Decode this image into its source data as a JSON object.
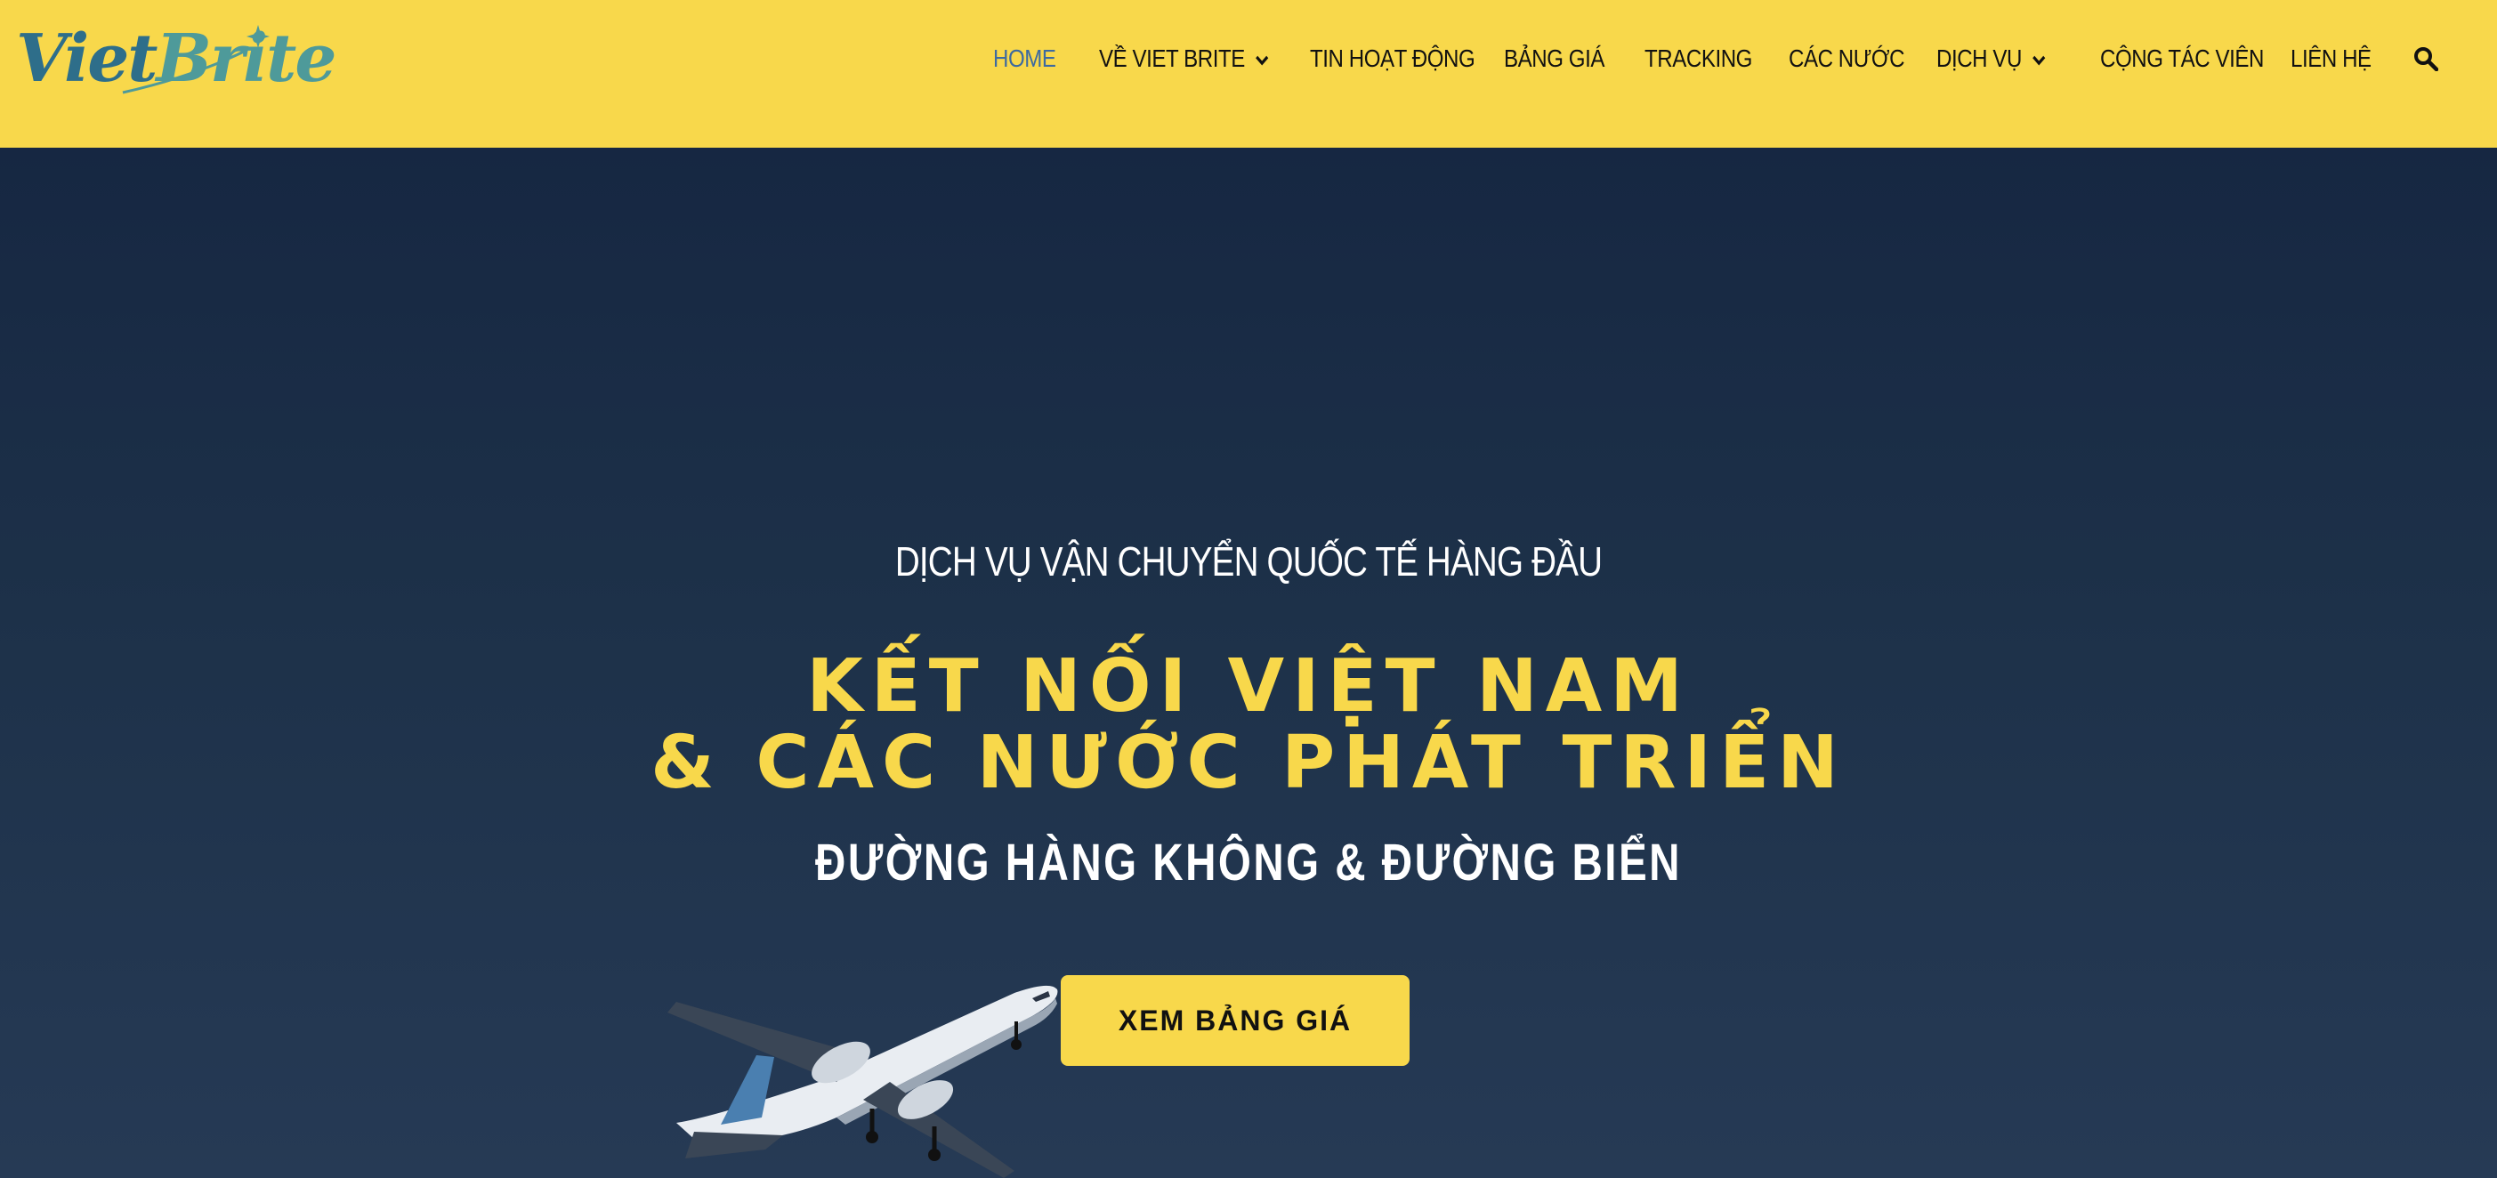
{
  "brand": {
    "logo_text_1": "Viet",
    "logo_text_2": "Brite"
  },
  "nav": {
    "items": [
      {
        "label": "HOME",
        "active": true
      },
      {
        "label": "VỀ VIET BRITE",
        "dropdown": true
      },
      {
        "label": "TIN HOẠT ĐỘNG"
      },
      {
        "label": "BẢNG GIÁ"
      },
      {
        "label": "TRACKING"
      },
      {
        "label": "CÁC NƯỚC"
      },
      {
        "label": "DỊCH VỤ",
        "dropdown": true
      },
      {
        "label": "CỘNG TÁC VIÊN"
      },
      {
        "label": "LIÊN HỆ"
      }
    ],
    "search_icon": "search-icon"
  },
  "hero": {
    "eyebrow": "DỊCH VỤ VẬN CHUYỂN QUỐC TẾ HÀNG ĐẦU",
    "headline_line1": "KẾT NỐI VIỆT NAM",
    "headline_line2": "& CÁC NƯỚC PHÁT TRIỂN",
    "subline": "ĐƯỜNG HÀNG KHÔNG & ĐƯỜNG BIỂN",
    "cta_label": "XEM BẢNG GIÁ"
  },
  "colors": {
    "header_bg": "#f8d84b",
    "hero_bg": "#1d3149",
    "accent_yellow": "#f8d84b",
    "nav_active": "#3d6aa0",
    "text_dark": "#111111",
    "text_light": "#ffffff"
  }
}
